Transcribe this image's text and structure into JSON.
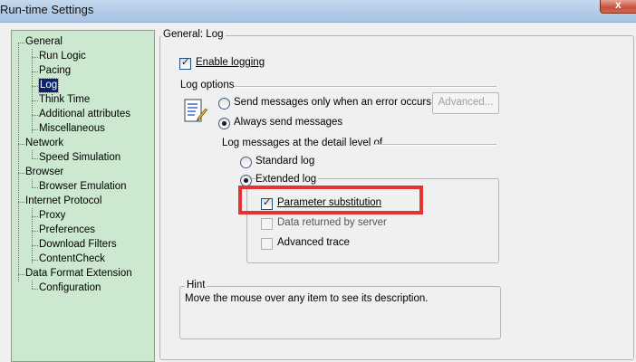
{
  "window": {
    "title": "Run-time Settings",
    "close_label": "x"
  },
  "tree": {
    "items": [
      {
        "label": "General",
        "level": 1
      },
      {
        "label": "Run Logic",
        "level": 2
      },
      {
        "label": "Pacing",
        "level": 2
      },
      {
        "label": "Log",
        "level": 2,
        "selected": true
      },
      {
        "label": "Think Time",
        "level": 2
      },
      {
        "label": "Additional attributes",
        "level": 2
      },
      {
        "label": "Miscellaneous",
        "level": 2
      },
      {
        "label": "Network",
        "level": 1
      },
      {
        "label": "Speed Simulation",
        "level": 2
      },
      {
        "label": "Browser",
        "level": 1
      },
      {
        "label": "Browser Emulation",
        "level": 2
      },
      {
        "label": "Internet Protocol",
        "level": 1
      },
      {
        "label": "Proxy",
        "level": 2
      },
      {
        "label": "Preferences",
        "level": 2
      },
      {
        "label": "Download Filters",
        "level": 2
      },
      {
        "label": "ContentCheck",
        "level": 2
      },
      {
        "label": "Data Format Extension",
        "level": 1
      },
      {
        "label": "Configuration",
        "level": 2
      }
    ]
  },
  "panel": {
    "title": "General: Log",
    "enable_logging": {
      "label": "Enable logging",
      "checked": true
    },
    "log_options_label": "Log options",
    "send_on_error": {
      "label": "Send messages only when an error occurs",
      "selected": false
    },
    "advanced_button": "Advanced...",
    "always_send": {
      "label": "Always send messages",
      "selected": true
    },
    "detail_level_label": "Log messages at the detail level of",
    "standard_log": {
      "label": "Standard log",
      "selected": false
    },
    "extended_log": {
      "label": "Extended log",
      "selected": true
    },
    "parameter_substitution": {
      "label": "Parameter substitution",
      "checked": true
    },
    "data_returned": {
      "label": "Data returned by server",
      "checked": false
    },
    "advanced_trace": {
      "label": "Advanced trace",
      "checked": false
    },
    "hint": {
      "label": "Hint",
      "text": "Move the mouse over any item to see its description."
    }
  },
  "highlight_color": "#e53330"
}
